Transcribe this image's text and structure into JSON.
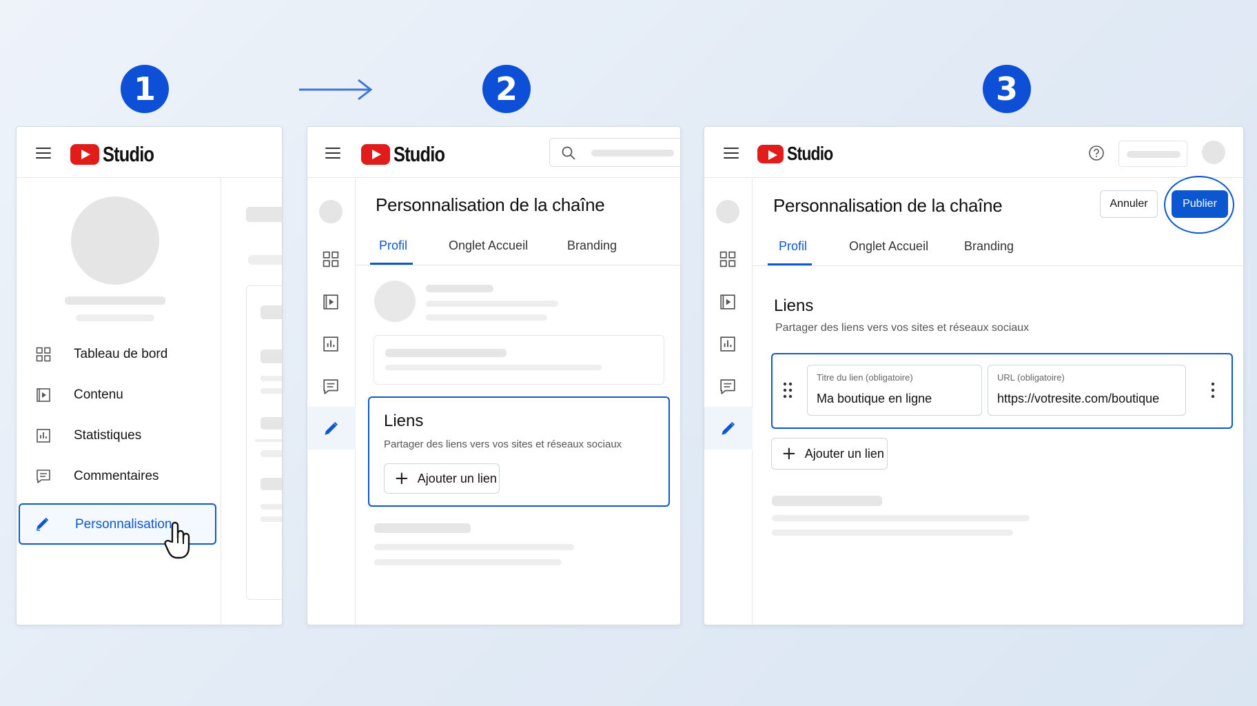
{
  "steps": [
    "1",
    "2",
    "3"
  ],
  "brand": {
    "name": "Studio",
    "accent": "#0b57d0",
    "badge_color": "#0d4fd6",
    "logo_red": "#e21b1b"
  },
  "panel1": {
    "nav": [
      {
        "label": "Tableau de bord",
        "icon": "dashboard-icon"
      },
      {
        "label": "Contenu",
        "icon": "content-icon"
      },
      {
        "label": "Statistiques",
        "icon": "analytics-icon"
      },
      {
        "label": "Commentaires",
        "icon": "comments-icon"
      },
      {
        "label": "Personnalisation",
        "icon": "customization-icon",
        "selected": true
      }
    ]
  },
  "panel2": {
    "page_title": "Personnalisation de la chaîne",
    "tabs": [
      "Profil",
      "Onglet Accueil",
      "Branding"
    ],
    "active_tab": "Profil",
    "links_card": {
      "title": "Liens",
      "subtitle": "Partager des liens vers vos sites et réseaux sociaux",
      "add_button": "Ajouter un lien"
    }
  },
  "panel3": {
    "page_title": "Personnalisation de la chaîne",
    "tabs": [
      "Profil",
      "Onglet Accueil",
      "Branding"
    ],
    "active_tab": "Profil",
    "cancel_button": "Annuler",
    "publish_button": "Publier",
    "links": {
      "title": "Liens",
      "subtitle": "Partager des liens vers vos sites et réseaux sociaux",
      "row": {
        "title_label": "Titre du lien (obligatoire)",
        "title_value": "Ma boutique en ligne",
        "url_label": "URL (obligatoire)",
        "url_value": "https://votresite.com/boutique"
      },
      "add_button": "Ajouter un lien"
    }
  }
}
